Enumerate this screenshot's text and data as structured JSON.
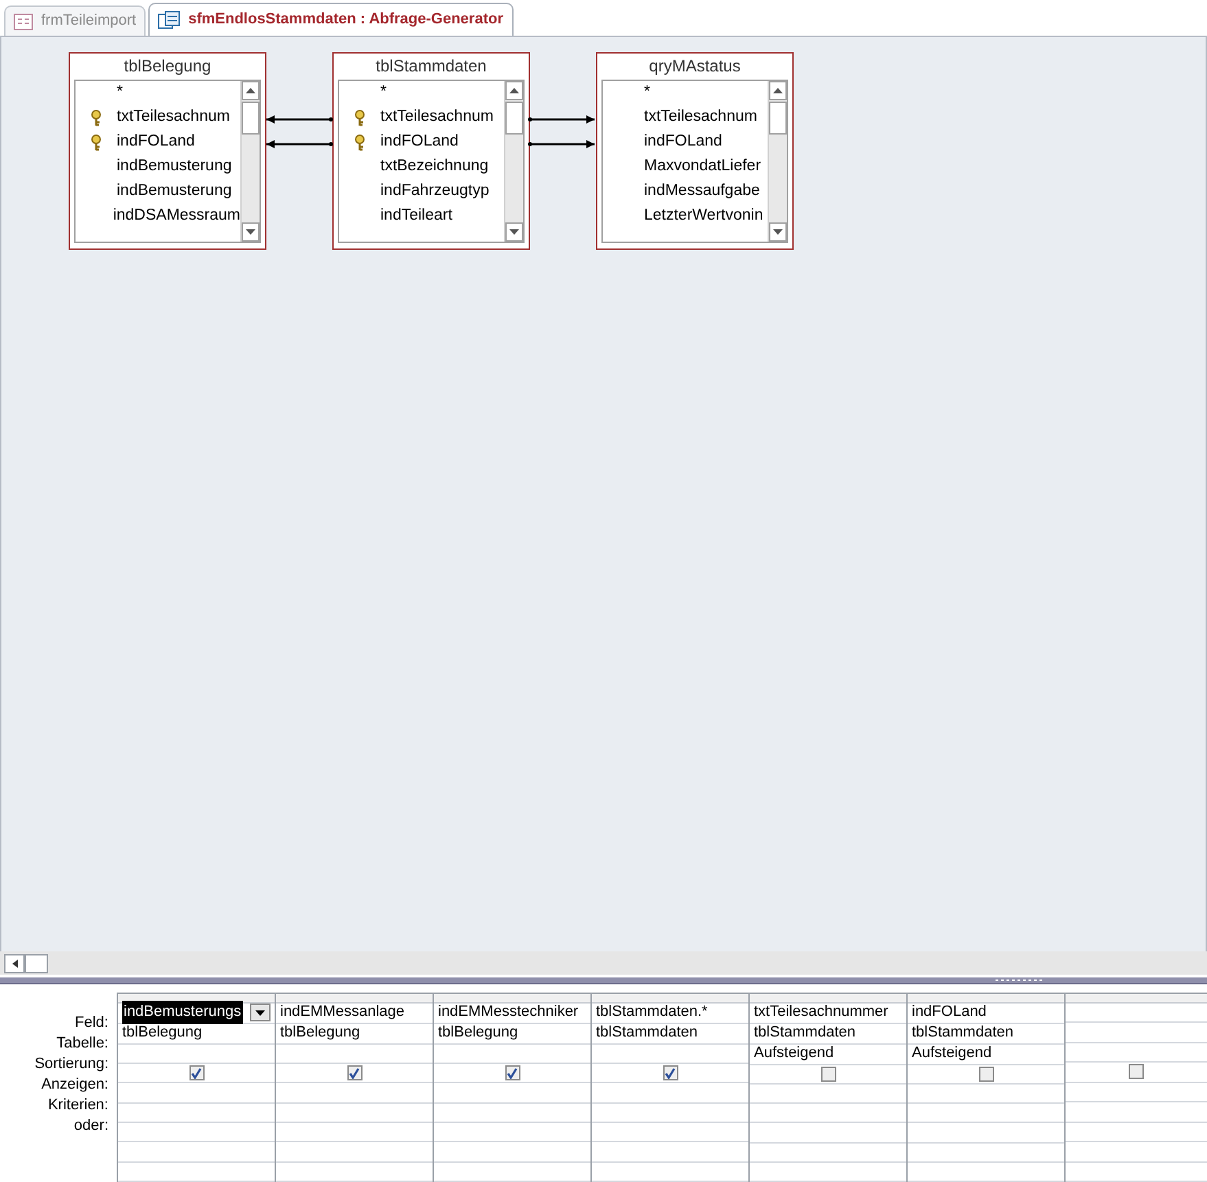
{
  "tabs": [
    {
      "label": "frmTeileimport",
      "selected": false,
      "kind": "form"
    },
    {
      "label": "sfmEndlosStammdaten : Abfrage-Generator",
      "selected": true,
      "kind": "query"
    }
  ],
  "field_lists": [
    {
      "title": "tblBelegung",
      "fields": [
        {
          "name": "*",
          "key": false
        },
        {
          "name": "txtTeilesachnum",
          "key": true
        },
        {
          "name": "indFOLand",
          "key": true
        },
        {
          "name": "indBemusterung",
          "key": false
        },
        {
          "name": "indBemusterung",
          "key": false
        },
        {
          "name": "indDSAMessraum",
          "key": false
        }
      ]
    },
    {
      "title": "tblStammdaten",
      "fields": [
        {
          "name": "*",
          "key": false
        },
        {
          "name": "txtTeilesachnum",
          "key": true
        },
        {
          "name": "indFOLand",
          "key": true
        },
        {
          "name": "txtBezeichnung",
          "key": false
        },
        {
          "name": "indFahrzeugtyp",
          "key": false
        },
        {
          "name": "indTeileart",
          "key": false
        }
      ]
    },
    {
      "title": "qryMAstatus",
      "fields": [
        {
          "name": "*",
          "key": false
        },
        {
          "name": "txtTeilesachnum",
          "key": false
        },
        {
          "name": "indFOLand",
          "key": false
        },
        {
          "name": "MaxvondatLiefer",
          "key": false
        },
        {
          "name": "indMessaufgabe",
          "key": false
        },
        {
          "name": "LetzterWertvonin",
          "key": false
        }
      ]
    }
  ],
  "grid": {
    "row_labels": [
      "Feld:",
      "Tabelle:",
      "Sortierung:",
      "Anzeigen:",
      "Kriterien:",
      "oder:"
    ],
    "columns": [
      {
        "field": "indBemusterungs",
        "table": "tblBelegung",
        "show": true,
        "selected": true
      },
      {
        "field": "indEMMessanlage",
        "table": "tblBelegung",
        "show": true,
        "selected": false
      },
      {
        "field": "indEMMesstechniker",
        "table": "tblBelegung",
        "show": true,
        "selected": false
      },
      {
        "field": "tblStammdaten.*",
        "table": "tblStammdaten",
        "show": true,
        "selected": false
      },
      {
        "field": "txtTeilesachnummer",
        "table": "tblStammdaten",
        "sort": "Aufsteigend",
        "show": false,
        "selected": false
      },
      {
        "field": "indFOLand",
        "table": "tblStammdaten",
        "sort": "Aufsteigend",
        "show": false,
        "selected": false
      },
      {
        "show": false,
        "selected": false
      }
    ]
  }
}
